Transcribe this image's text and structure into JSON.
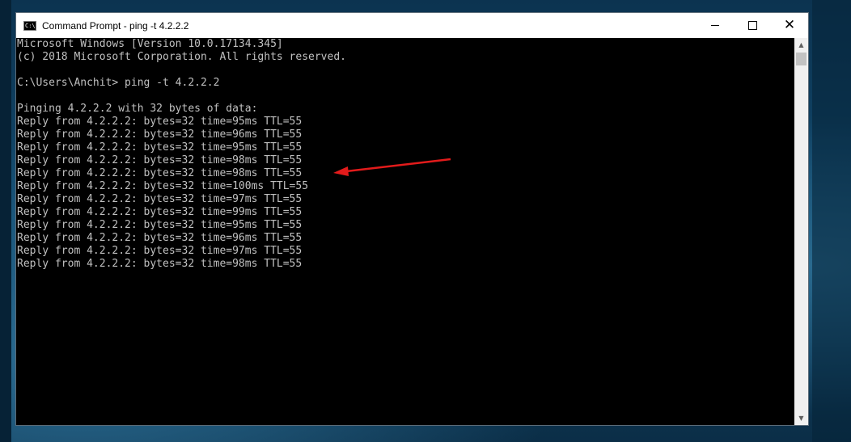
{
  "window": {
    "title": "Command Prompt - ping  -t 4.2.2.2",
    "app_icon_text": "C:\\",
    "close_glyph": "✕"
  },
  "console": {
    "lines": [
      "Microsoft Windows [Version 10.0.17134.345]",
      "(c) 2018 Microsoft Corporation. All rights reserved.",
      "",
      "C:\\Users\\Anchit> ping -t 4.2.2.2",
      "",
      "Pinging 4.2.2.2 with 32 bytes of data:",
      "Reply from 4.2.2.2: bytes=32 time=95ms TTL=55",
      "Reply from 4.2.2.2: bytes=32 time=96ms TTL=55",
      "Reply from 4.2.2.2: bytes=32 time=95ms TTL=55",
      "Reply from 4.2.2.2: bytes=32 time=98ms TTL=55",
      "Reply from 4.2.2.2: bytes=32 time=98ms TTL=55",
      "Reply from 4.2.2.2: bytes=32 time=100ms TTL=55",
      "Reply from 4.2.2.2: bytes=32 time=97ms TTL=55",
      "Reply from 4.2.2.2: bytes=32 time=99ms TTL=55",
      "Reply from 4.2.2.2: bytes=32 time=95ms TTL=55",
      "Reply from 4.2.2.2: bytes=32 time=96ms TTL=55",
      "Reply from 4.2.2.2: bytes=32 time=97ms TTL=55",
      "Reply from 4.2.2.2: bytes=32 time=98ms TTL=55"
    ]
  },
  "colors": {
    "console_bg": "#000000",
    "console_text": "#c0c0c0",
    "titlebar_bg": "#ffffff",
    "annotation_arrow": "#e21b1b"
  },
  "icons": {
    "app": "cmd-icon",
    "minimize": "minimize-icon",
    "maximize": "maximize-icon",
    "close": "close-icon",
    "scroll_up": "chevron-up-icon",
    "scroll_down": "chevron-down-icon",
    "annotation": "red-arrow-icon"
  }
}
